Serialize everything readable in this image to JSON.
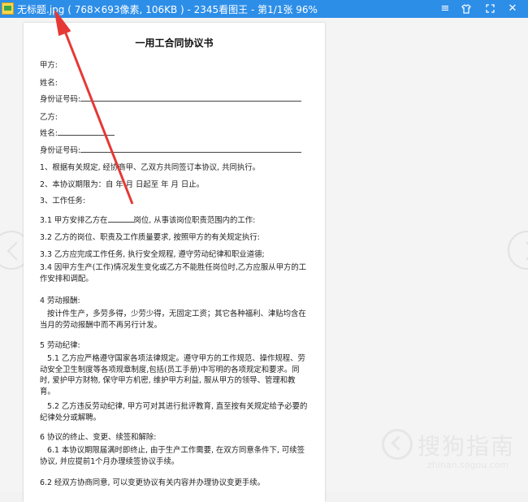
{
  "window": {
    "title": "无标题.jpg ( 768×693像素, 106KB ) - 2345看图王 - 第1/1张 96%",
    "menu_icon": "menu-icon",
    "skin_icon": "skin-icon",
    "fullscreen_icon": "fullscreen-icon",
    "close_icon": "close-icon"
  },
  "document": {
    "title": "一用工合同协议书",
    "party_a": "甲方:",
    "name_a": "姓名:",
    "id_a": "身份证号码:",
    "party_b": "乙方:",
    "name_b": "姓名:",
    "id_b": "身份证号码:",
    "clause1": "1、根据有关规定, 经协商甲、乙双方共同签订本协议, 共同执行。",
    "clause2": "2、本协议期限为：自    年    月    日起至    年    月    日止。",
    "clause3": "3、工作任务:",
    "c3_1a": "3.1 甲方安排乙方在",
    "c3_1b": "岗位, 从事该岗位职责范围内的工作:",
    "c3_2": "3.2 乙方的岗位、职责及工作质量要求, 按照甲方的有关规定执行:",
    "c3_3": "3.3 乙方应完成工作任务, 执行安全规程, 遵守劳动纪律和职业道德;",
    "c3_4": "3.4 因甲方生产(工作)情况发生变化或乙方不能胜任岗位时,乙方应服从甲方的工作安排和调配。",
    "clause4": "4 劳动报酬:",
    "c4_body": "按计件生产，多劳多得，少劳少得，无固定工资；其它各种福利、津贴均含在当月的劳动报酬中而不再另行计发。",
    "clause5": "5 劳动纪律:",
    "c5_1": "5.1 乙方应严格遵守国家各项法律规定。遵守甲方的工作规范、操作规程、劳动安全卫生制度等各项规章制度,包括(员工手册)中写明的各项规定和要求。同时, 爱护甲方财物, 保守甲方机密, 维护甲方利益, 服从甲方的领导、管理和教育。",
    "c5_2": "5.2 乙方违反劳动纪律, 甲方可对其进行批评教育, 直至按有关规定给予必要的纪律处分或解聘。",
    "clause6": "6 协议的终止、变更、续签和解除:",
    "c6_1": "6.1 本协议期限届满时即终止, 由于生产工作需要, 在双方同意条件下, 可续签协议, 并应提前1个月办理续签协议手续。",
    "c6_2": "6.2 经双方协商同意, 可以变更协议有关内容并办理协议变更手续。"
  },
  "watermark": {
    "brand": "搜狗指南",
    "url": "zhinan.sogou.com"
  },
  "colors": {
    "titlebar": "#2d8ee8",
    "annotation": "#e53935"
  }
}
